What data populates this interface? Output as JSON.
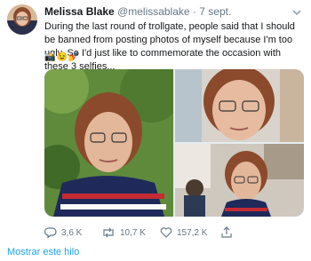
{
  "tweet": {
    "author_name": "Melissa Blake",
    "author_handle": "@melissablake",
    "separator": "·",
    "timestamp": "7 sept.",
    "text": "During the last round of trollgate, people said that I should be banned from posting photos of myself because I'm too ugly. So I'd just like to commemorate the occasion with these 3 selfies...",
    "emojis": "📸😉💅",
    "images": [
      "selfie-outdoor",
      "selfie-indoor-closeup",
      "selfie-restaurant"
    ],
    "actions": {
      "reply_count": "3,6 K",
      "retweet_count": "10,7 K",
      "like_count": "157,2 K"
    },
    "show_thread_label": "Mostrar este hilo"
  },
  "colors": {
    "link": "#1da1f2",
    "secondary_text": "#657786"
  }
}
